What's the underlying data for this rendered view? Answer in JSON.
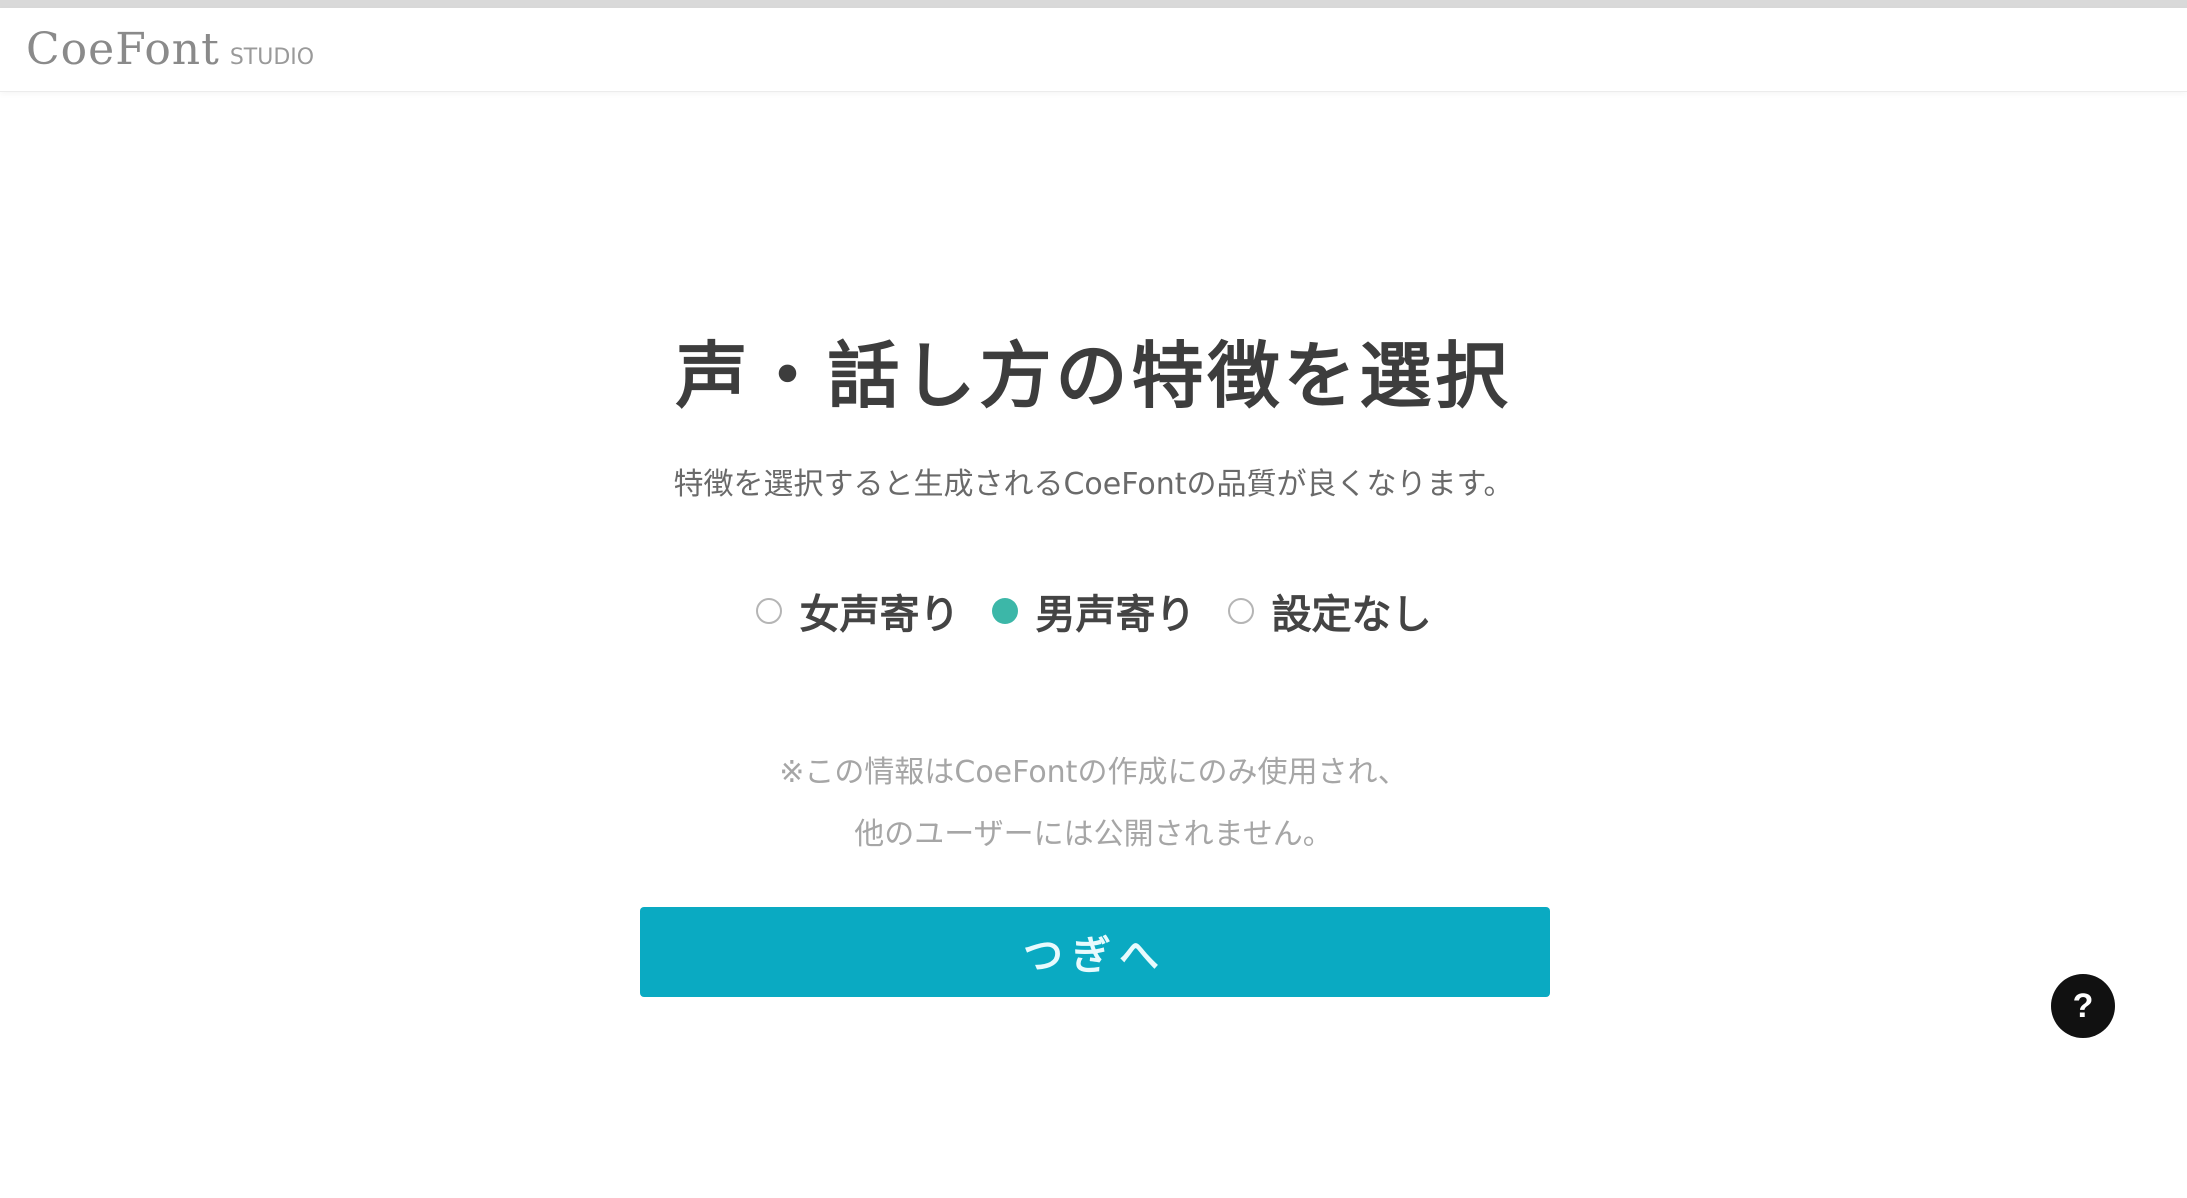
{
  "header": {
    "logo_name": "CoeFont",
    "logo_sub": "STUDIO"
  },
  "main": {
    "title": "声・話し方の特徴を選択",
    "subtitle": "特徴を選択すると生成されるCoeFontの品質が良くなります。",
    "options": [
      {
        "label": "女声寄り",
        "selected": false
      },
      {
        "label": "男声寄り",
        "selected": true
      },
      {
        "label": "設定なし",
        "selected": false
      }
    ],
    "note_line1": "※この情報はCoeFontの作成にのみ使用され、",
    "note_line2": "他のユーザーには公開されません。",
    "next_label": "つぎへ"
  },
  "help": {
    "icon_glyph": "?"
  },
  "colors": {
    "accent": "#0aaac2",
    "radio_selected": "#3cb7a8"
  }
}
